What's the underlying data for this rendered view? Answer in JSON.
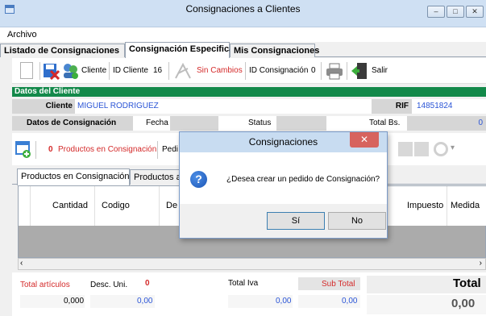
{
  "window": {
    "title": "Consignaciones a Clientes",
    "controls": {
      "minimize": "–",
      "maximize": "□",
      "close": "✕"
    }
  },
  "menu": {
    "archivo": "Archivo"
  },
  "main_tabs": [
    "Listado de Consignaciones",
    "Consignación Especifica",
    "Mis Consignaciones"
  ],
  "toolbar": {
    "cliente": "Cliente",
    "id_cliente_label": "ID Cliente",
    "id_cliente_value": "16",
    "sin_cambios": "Sin Cambios",
    "id_consignacion_label": "ID Consignación",
    "id_consignacion_value": "0",
    "salir": "Salir"
  },
  "cliente_section": {
    "header": "Datos del Cliente",
    "cliente_label": "Cliente",
    "cliente_value": "MIGUEL RODRIGUEZ",
    "rif_label": "RIF",
    "rif_value": "14851824"
  },
  "consignacion": {
    "label": "Datos de Consignación",
    "fecha_label": "Fecha",
    "status_label": "Status",
    "total_bs_label": "Total Bs.",
    "total_bs_value": "0"
  },
  "productos_toolbar": {
    "count": "0",
    "label": "Productos en Consignación",
    "partial": "Pedi"
  },
  "sub_tabs": [
    "Productos en Consignación",
    "Productos a"
  ],
  "grid": {
    "columns": [
      "Cantidad",
      "Codigo",
      "De",
      "Impuesto",
      "Medida"
    ]
  },
  "totals": {
    "total_articulos_label": "Total artículos",
    "total_articulos_value": "0,000",
    "desc_uni_label": "Desc. Uni.",
    "desc_uni_value": "0",
    "desc_uni_amount": "0,00",
    "total_iva_label": "Total Iva",
    "total_iva_value": "0,00",
    "sub_total_label": "Sub Total",
    "sub_total_value": "0,00",
    "total_label": "Total",
    "total_value": "0,00"
  },
  "dialog": {
    "title": "Consignaciones",
    "close": "✕",
    "message": "¿Desea crear un pedido de Consignación?",
    "yes": "Sí",
    "no": "No"
  },
  "colors": {
    "accent_green": "#13894a",
    "link_blue": "#2a54d6",
    "alert_red": "#d42a2a"
  }
}
